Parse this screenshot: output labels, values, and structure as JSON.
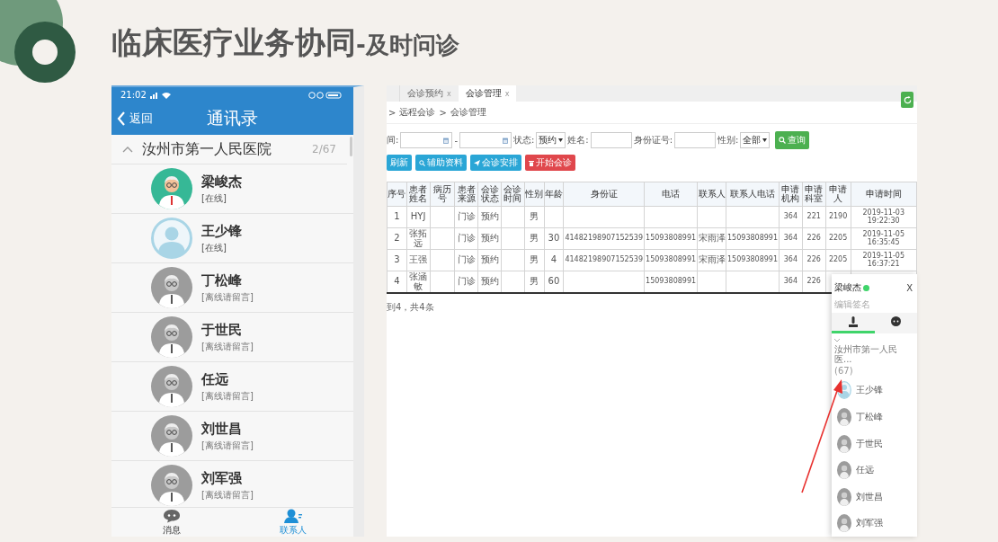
{
  "slide": {
    "title": "临床医疗业务协同",
    "subtitle": "-及时问诊"
  },
  "phone": {
    "time": "21:02",
    "back": "返回",
    "title": "通讯录",
    "group": {
      "name": "汝州市第一人民医院",
      "count": "2/67",
      "expanded": true
    },
    "contacts": [
      {
        "name": "梁峻杰",
        "status": "[在线]",
        "online": true,
        "kind": "doctor"
      },
      {
        "name": "王少锋",
        "status": "[在线]",
        "online": true,
        "kind": "person"
      },
      {
        "name": "丁松峰",
        "status": "[离线请留言]",
        "online": false,
        "kind": "doctor"
      },
      {
        "name": "于世民",
        "status": "[离线请留言]",
        "online": false,
        "kind": "doctor"
      },
      {
        "name": "任远",
        "status": "[离线请留言]",
        "online": false,
        "kind": "doctor"
      },
      {
        "name": "刘世昌",
        "status": "[离线请留言]",
        "online": false,
        "kind": "doctor"
      },
      {
        "name": "刘军强",
        "status": "[离线请留言]",
        "online": false,
        "kind": "doctor"
      }
    ],
    "tabs": [
      {
        "label": "消息",
        "kind": "chat",
        "selected": false
      },
      {
        "label": "联系人",
        "kind": "contacts",
        "selected": true
      }
    ]
  },
  "web": {
    "tabs": [
      {
        "label": "会诊预约",
        "close": "x",
        "selected": false
      },
      {
        "label": "会诊管理",
        "close": "x",
        "selected": true
      }
    ],
    "breadcrumb": [
      ">",
      "远程会诊",
      ">",
      "会诊管理"
    ],
    "filters": [
      {
        "kind": "date",
        "label": "间:"
      },
      {
        "kind": "dash",
        "label": "-"
      },
      {
        "kind": "date"
      },
      {
        "kind": "select",
        "label": "状态:",
        "value": "预约"
      },
      {
        "kind": "input",
        "label": "姓名:"
      },
      {
        "kind": "input",
        "label": "身份证号:"
      },
      {
        "kind": "select",
        "label": "性别:",
        "value": "全部"
      }
    ],
    "search_button": "查询",
    "actions": [
      {
        "label": "刷新",
        "kind": "none",
        "color": "#2aa6d6"
      },
      {
        "label": "辅助资料",
        "kind": "search",
        "color": "#2aa6d6"
      },
      {
        "label": "会诊安排",
        "kind": "send",
        "color": "#2aa6d6"
      },
      {
        "label": "开始会诊",
        "kind": "trash",
        "color": "#e0474c"
      }
    ],
    "table": {
      "columns": [
        "序号",
        "患者姓名",
        "病历号",
        "患者来源",
        "会诊状态",
        "会诊时间",
        "性别",
        "年龄",
        "身份证",
        "电话",
        "联系人",
        "联系人电话",
        "申请机构",
        "申请科室",
        "申请人",
        "申请时间"
      ],
      "rows": [
        [
          "1",
          "HYJ",
          "",
          "门诊",
          "预约",
          "",
          "男",
          "",
          "",
          "",
          "",
          "",
          "364",
          "221",
          "2190",
          "2019-11-03 19:22:30"
        ],
        [
          "2",
          "张拓远",
          "",
          "门诊",
          "预约",
          "",
          "男",
          "30",
          "41482198907152539",
          "15093808991",
          "宋雨泽",
          "15093808991",
          "364",
          "226",
          "2205",
          "2019-11-05 16:35:45"
        ],
        [
          "3",
          "王强",
          "",
          "门诊",
          "预约",
          "",
          "男",
          "4",
          "41482198907152539",
          "15093808991",
          "宋雨泽",
          "15093808991",
          "364",
          "226",
          "2205",
          "2019-11-05 16:37:21"
        ],
        [
          "4",
          "张涵敏",
          "",
          "门诊",
          "预约",
          "",
          "男",
          "60",
          "",
          "15093808991",
          "",
          "",
          "364",
          "226"
        ]
      ]
    },
    "footer": "到4，共4条",
    "chat": {
      "user": "梁峻杰",
      "online": true,
      "close": "X",
      "signature_placeholder": "编辑签名",
      "tabs": [
        {
          "kind": "person",
          "selected": true
        },
        {
          "kind": "chat",
          "selected": false
        }
      ],
      "group": {
        "name": "汝州市第一人民医...",
        "count": "(67)",
        "expanded": true
      },
      "contacts": [
        {
          "name": "王少锋",
          "kind": "person"
        },
        {
          "name": "丁松峰",
          "kind": "doctor"
        },
        {
          "name": "于世民",
          "kind": "doctor"
        },
        {
          "name": "任远",
          "kind": "doctor"
        },
        {
          "name": "刘世昌",
          "kind": "doctor"
        },
        {
          "name": "刘军强",
          "kind": "doctor"
        }
      ]
    }
  }
}
